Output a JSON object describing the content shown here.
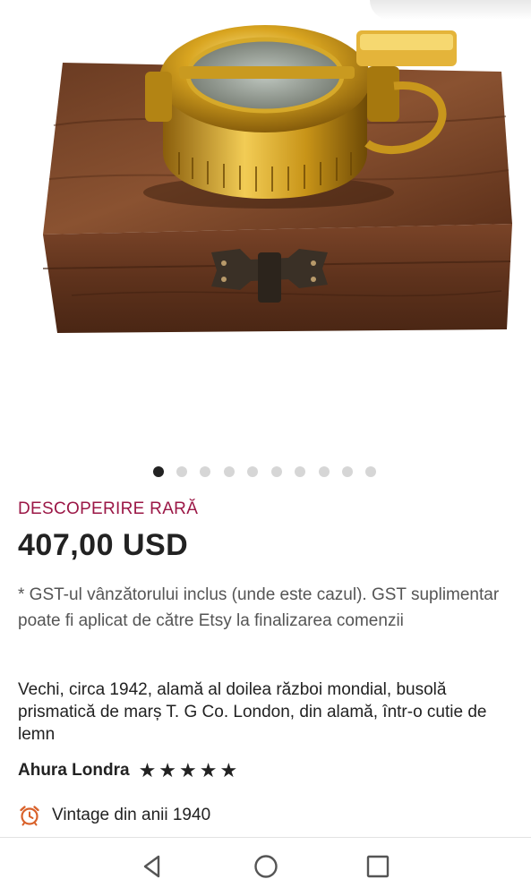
{
  "product": {
    "image_icon": "compass-in-wooden-box-photo",
    "gallery_count": 10,
    "gallery_active_index": 0,
    "badge": "DESCOPERIRE RARĂ",
    "price": "407,00 USD",
    "tax_note": "* GST-ul vânzătorului inclus (unde este cazul). GST suplimentar poate fi aplicat de către Etsy la finalizarea comenzii",
    "title": "Vechi, circa 1942, alamă al doilea război mondial, busolă prismatică de marș T. G Co. London, din alamă, într-o cutie de lemn"
  },
  "shop": {
    "name": "Ahura Londra",
    "rating": 5,
    "rating_max": 5
  },
  "vintage": {
    "icon": "alarm-clock-icon",
    "label": "Vintage din anii 1940"
  },
  "navbar": {
    "back_icon": "back-triangle-icon",
    "home_icon": "home-circle-icon",
    "recents_icon": "recents-square-icon"
  },
  "colors": {
    "badge": "#9b1746",
    "text": "#222222",
    "muted": "#555555",
    "dot_active": "#222222",
    "dot_inactive": "#d6d6d6"
  }
}
